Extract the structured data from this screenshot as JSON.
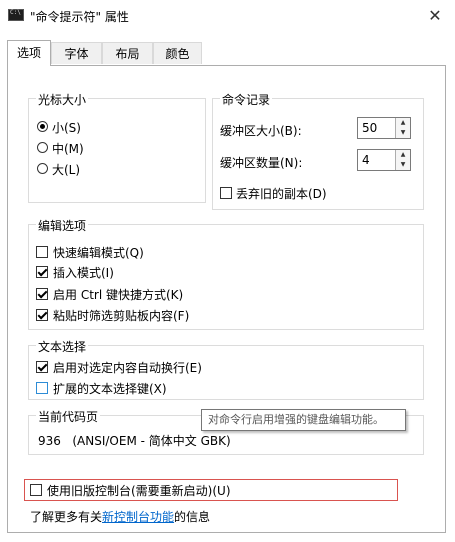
{
  "window": {
    "title": "\"命令提示符\" 属性",
    "close_glyph": "✕"
  },
  "tabs": [
    {
      "label": "选项",
      "active": true
    },
    {
      "label": "字体",
      "active": false
    },
    {
      "label": "布局",
      "active": false
    },
    {
      "label": "颜色",
      "active": false
    }
  ],
  "cursor_size": {
    "title": "光标大小",
    "options": [
      {
        "label": "小(S)",
        "selected": true
      },
      {
        "label": "中(M)",
        "selected": false
      },
      {
        "label": "大(L)",
        "selected": false
      }
    ]
  },
  "command_history": {
    "title": "命令记录",
    "buffer_size_label": "缓冲区大小(B):",
    "buffer_size_value": "50",
    "buffer_count_label": "缓冲区数量(N):",
    "buffer_count_value": "4",
    "discard_label": "丢弃旧的副本(D)",
    "discard_checked": false
  },
  "edit_options": {
    "title": "编辑选项",
    "items": [
      {
        "label": "快速编辑模式(Q)",
        "checked": false
      },
      {
        "label": "插入模式(I)",
        "checked": true
      },
      {
        "label": "启用 Ctrl 键快捷方式(K)",
        "checked": true
      },
      {
        "label": "粘贴时筛选剪贴板内容(F)",
        "checked": true
      }
    ]
  },
  "text_selection": {
    "title": "文本选择",
    "items": [
      {
        "label": "启用对选定内容自动换行(E)",
        "checked": true
      },
      {
        "label": "扩展的文本选择键(X)",
        "checked": false
      }
    ]
  },
  "code_page": {
    "title": "当前代码页",
    "value": "936   (ANSI/OEM - 简体中文 GBK)"
  },
  "tooltip": "对命令行启用增强的键盘编辑功能。",
  "legacy": {
    "label": "使用旧版控制台(需要重新启动)(U)",
    "checked": false
  },
  "learn_more": {
    "prefix": "了解更多有关",
    "link": "新控制台功能",
    "suffix": "的信息"
  },
  "colors": {
    "accent_link": "#0066cc",
    "highlight_border": "#d9534f"
  }
}
